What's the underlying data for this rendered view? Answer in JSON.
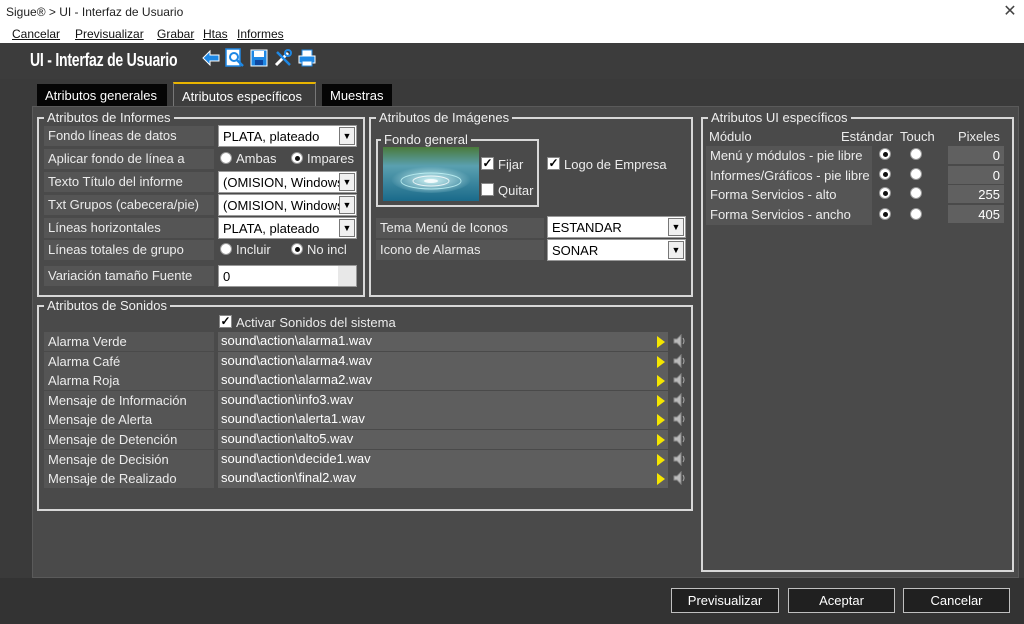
{
  "window": {
    "title": "Sigue® > UI - Interfaz de Usuario",
    "close_glyph": "✕"
  },
  "menu": {
    "items": [
      "Cancelar",
      "Previsualizar",
      "Grabar",
      "Htas",
      "Informes"
    ]
  },
  "header": {
    "title": "UI - Interfaz de Usuario",
    "icons": [
      "back-arrow-icon",
      "zoom-preview-icon",
      "save-disk-icon",
      "tools-icon",
      "print-icon"
    ]
  },
  "tabs": [
    {
      "label": "Atributos generales",
      "active": false
    },
    {
      "label": "Atributos específicos",
      "active": true
    },
    {
      "label": "Muestras",
      "active": false
    }
  ],
  "informes": {
    "legend": "Atributos de Informes",
    "fondo_lineas": {
      "label": "Fondo líneas de datos",
      "value": "PLATA, plateado"
    },
    "aplicar_fondo": {
      "label": "Aplicar fondo de línea a",
      "options": [
        "Ambas",
        "Impares"
      ],
      "selected": "Impares"
    },
    "texto_titulo": {
      "label": "Texto Título del informe",
      "value": "(OMISION, Windows)"
    },
    "txt_grupos": {
      "label": "Txt Grupos (cabecera/pie)",
      "value": "(OMISION, Windows)"
    },
    "lineas_horizontales": {
      "label": "Líneas horizontales",
      "value": "PLATA, plateado"
    },
    "lineas_totales": {
      "label": "Líneas totales de grupo",
      "options": [
        "Incluir",
        "No incl"
      ],
      "selected": "No incl"
    },
    "variacion_fuente": {
      "label": "Variación tamaño Fuente",
      "value": "0"
    }
  },
  "imagenes": {
    "legend": "Atributos de Imágenes",
    "fondo_general": {
      "legend": "Fondo general",
      "fijar_label": "Fijar",
      "fijar_checked": true,
      "quitar_label": "Quitar",
      "quitar_checked": false
    },
    "logo_empresa": {
      "label": "Logo de Empresa",
      "checked": true
    },
    "tema_menu": {
      "label": "Tema Menú de Iconos",
      "value": "ESTANDAR"
    },
    "icono_alarmas": {
      "label": "Icono de Alarmas",
      "value": "SONAR"
    }
  },
  "ui_especificos": {
    "legend": "Atributos UI específicos",
    "headers": {
      "modulo": "Módulo",
      "estandar": "Estándar",
      "touch": "Touch",
      "pixeles": "Pixeles"
    },
    "rows": [
      {
        "label": "Menú y módulos - pie libre",
        "selected": "estandar",
        "pixels": "0"
      },
      {
        "label": "Informes/Gráficos - pie libre",
        "selected": "estandar",
        "pixels": "0"
      },
      {
        "label": "Forma Servicios - alto",
        "selected": "estandar",
        "pixels": "255"
      },
      {
        "label": "Forma Servicios - ancho",
        "selected": "estandar",
        "pixels": "405"
      }
    ]
  },
  "sonidos": {
    "legend": "Atributos de Sonidos",
    "activar": {
      "label": "Activar Sonidos del sistema",
      "checked": true
    },
    "rows": [
      {
        "label": "Alarma Verde",
        "file": "sound\\action\\alarma1.wav"
      },
      {
        "label": "Alarma Café",
        "file": "sound\\action\\alarma4.wav"
      },
      {
        "label": "Alarma Roja",
        "file": "sound\\action\\alarma2.wav"
      },
      {
        "label": "Mensaje de Información",
        "file": "sound\\action\\info3.wav"
      },
      {
        "label": "Mensaje de Alerta",
        "file": "sound\\action\\alerta1.wav"
      },
      {
        "label": "Mensaje de Detención",
        "file": "sound\\action\\alto5.wav"
      },
      {
        "label": "Mensaje de Decisión",
        "file": "sound\\action\\decide1.wav"
      },
      {
        "label": "Mensaje de Realizado",
        "file": "sound\\action\\final2.wav"
      }
    ]
  },
  "buttons": {
    "previsualizar": "Previsualizar",
    "aceptar": "Aceptar",
    "cancelar": "Cancelar"
  },
  "colors": {
    "tab_accent": "#e8b400",
    "play_arrow": "#f5e600",
    "panel": "#4a4a4a",
    "background": "#3a3a3a"
  }
}
